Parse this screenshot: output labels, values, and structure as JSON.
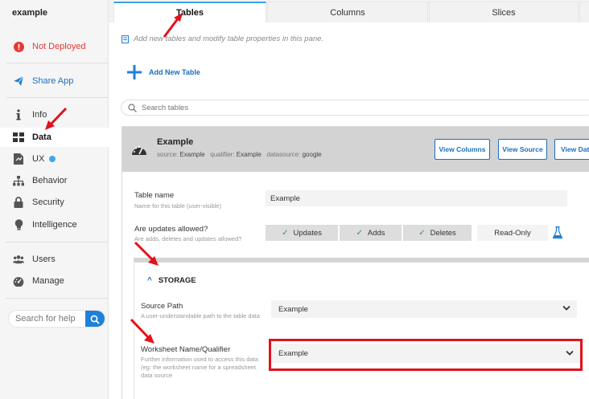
{
  "app": {
    "name": "example"
  },
  "sidebar": {
    "status": {
      "label": "Not Deployed",
      "color": "#e53935"
    },
    "share": {
      "label": "Share App"
    },
    "nav": [
      {
        "label": "Info",
        "icon": "info-icon"
      },
      {
        "label": "Data",
        "icon": "grid-icon",
        "active": true
      },
      {
        "label": "UX",
        "icon": "ux-icon"
      },
      {
        "label": "Behavior",
        "icon": "hierarchy-icon"
      },
      {
        "label": "Security",
        "icon": "lock-icon"
      },
      {
        "label": "Intelligence",
        "icon": "bulb-icon"
      }
    ],
    "admin": [
      {
        "label": "Users",
        "icon": "users-icon"
      },
      {
        "label": "Manage",
        "icon": "dashboard-icon"
      }
    ],
    "help_search": {
      "placeholder": "Search for help"
    }
  },
  "tabs": [
    {
      "label": "Tables",
      "active": true
    },
    {
      "label": "Columns"
    },
    {
      "label": "Slices"
    }
  ],
  "main": {
    "hint": "Add new tables and modify table properties in this pane.",
    "add_table": "Add New Table",
    "search_placeholder": "Search tables",
    "table": {
      "name": "Example",
      "source_label": "source:",
      "source_value": "Example",
      "qualifier_label": "qualifier:",
      "qualifier_value": "Example",
      "datasource_label": "datasource:",
      "datasource_value": "google",
      "buttons": {
        "view_columns": "View Columns",
        "view_source": "View Source",
        "view_data": "View Data"
      },
      "table_name": {
        "label": "Table name",
        "desc": "Name for this table (user-visible)",
        "value": "Example"
      },
      "updates": {
        "label": "Are updates allowed?",
        "desc": "Are adds, deletes and updates allowed?",
        "options": [
          "Updates",
          "Adds",
          "Deletes",
          "Read-Only"
        ]
      },
      "storage": {
        "title": "STORAGE",
        "source_path": {
          "label": "Source Path",
          "desc": "A user-understandable path to the table data",
          "value": "Example"
        },
        "worksheet": {
          "label": "Worksheet Name/Qualifier",
          "desc": "Further information used to access this data (eg: the worksheet name for a spreadsheet data source",
          "value": "Example"
        }
      }
    }
  },
  "colors": {
    "accent": "#1a6fc0",
    "tab_accent": "#3aa0e8",
    "highlight": "#e0121b",
    "ux_dot": "#3fa9e6"
  }
}
